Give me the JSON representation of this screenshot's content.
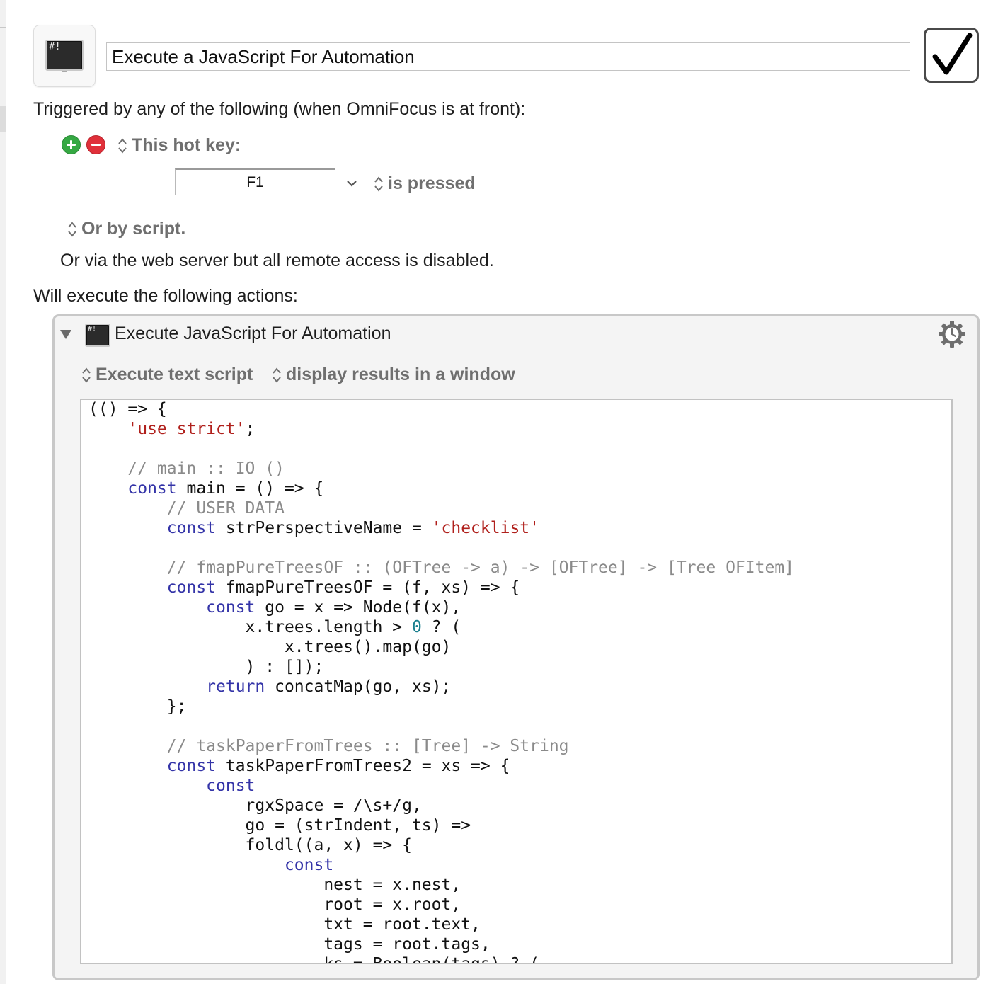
{
  "macro": {
    "icon": "terminal-icon",
    "icon_text": "#!",
    "name": "Execute a JavaScript For Automation",
    "enabled": true
  },
  "triggers": {
    "heading": "Triggered by any of the following (when OmniFocus is at front):",
    "trigger_type": "This hot key:",
    "hotkey": "F1",
    "hotkey_condition": "is pressed",
    "script_option": "Or by script.",
    "web_server_note": "Or via the web server but all remote access is disabled."
  },
  "actions": {
    "heading": "Will execute the following actions:",
    "items": [
      {
        "title": "Execute JavaScript For Automation",
        "icon": "terminal-icon",
        "icon_text": "#!",
        "source_option": "Execute text script",
        "output_option": "display results in a window",
        "code_lines": [
          [
            {
              "t": "(() => {",
              "c": "plain"
            }
          ],
          [
            {
              "t": "    ",
              "c": "plain"
            },
            {
              "t": "'use strict'",
              "c": "str"
            },
            {
              "t": ";",
              "c": "plain"
            }
          ],
          [
            {
              "t": "",
              "c": "plain"
            }
          ],
          [
            {
              "t": "    // main :: IO ()",
              "c": "com"
            }
          ],
          [
            {
              "t": "    ",
              "c": "plain"
            },
            {
              "t": "const",
              "c": "kw"
            },
            {
              "t": " main = () => {",
              "c": "plain"
            }
          ],
          [
            {
              "t": "        // USER DATA",
              "c": "com"
            }
          ],
          [
            {
              "t": "        ",
              "c": "plain"
            },
            {
              "t": "const",
              "c": "kw"
            },
            {
              "t": " strPerspectiveName = ",
              "c": "plain"
            },
            {
              "t": "'checklist'",
              "c": "str"
            }
          ],
          [
            {
              "t": "",
              "c": "plain"
            }
          ],
          [
            {
              "t": "        // fmapPureTreesOF :: (OFTree -> a) -> [OFTree] -> [Tree OFItem]",
              "c": "com"
            }
          ],
          [
            {
              "t": "        ",
              "c": "plain"
            },
            {
              "t": "const",
              "c": "kw"
            },
            {
              "t": " fmapPureTreesOF = (f, xs) => {",
              "c": "plain"
            }
          ],
          [
            {
              "t": "            ",
              "c": "plain"
            },
            {
              "t": "const",
              "c": "kw"
            },
            {
              "t": " go = x => Node(f(x),",
              "c": "plain"
            }
          ],
          [
            {
              "t": "                x.trees.length > ",
              "c": "plain"
            },
            {
              "t": "0",
              "c": "num"
            },
            {
              "t": " ? (",
              "c": "plain"
            }
          ],
          [
            {
              "t": "                    x.trees().map(go)",
              "c": "plain"
            }
          ],
          [
            {
              "t": "                ) : []);",
              "c": "plain"
            }
          ],
          [
            {
              "t": "            ",
              "c": "plain"
            },
            {
              "t": "return",
              "c": "kw"
            },
            {
              "t": " concatMap(go, xs);",
              "c": "plain"
            }
          ],
          [
            {
              "t": "        };",
              "c": "plain"
            }
          ],
          [
            {
              "t": "",
              "c": "plain"
            }
          ],
          [
            {
              "t": "        // taskPaperFromTrees :: [Tree] -> String",
              "c": "com"
            }
          ],
          [
            {
              "t": "        ",
              "c": "plain"
            },
            {
              "t": "const",
              "c": "kw"
            },
            {
              "t": " taskPaperFromTrees2 = xs => {",
              "c": "plain"
            }
          ],
          [
            {
              "t": "            ",
              "c": "plain"
            },
            {
              "t": "const",
              "c": "kw"
            }
          ],
          [
            {
              "t": "                rgxSpace = /\\s+/g,",
              "c": "plain"
            }
          ],
          [
            {
              "t": "                go = (strIndent, ts) =>",
              "c": "plain"
            }
          ],
          [
            {
              "t": "                foldl((a, x) => {",
              "c": "plain"
            }
          ],
          [
            {
              "t": "                    ",
              "c": "plain"
            },
            {
              "t": "const",
              "c": "kw"
            }
          ],
          [
            {
              "t": "                        nest = x.nest,",
              "c": "plain"
            }
          ],
          [
            {
              "t": "                        root = x.root,",
              "c": "plain"
            }
          ],
          [
            {
              "t": "                        txt = root.text,",
              "c": "plain"
            }
          ],
          [
            {
              "t": "                        tags = root.tags,",
              "c": "plain"
            }
          ],
          [
            {
              "t": "                        ks = Boolean(tags) ? (",
              "c": "plain"
            }
          ]
        ]
      }
    ]
  },
  "colors": {
    "keyword": "#3434a8",
    "string": "#b0201c",
    "comment": "#8a8a8a",
    "number": "#1a7f8e",
    "add_button": "#35a843",
    "remove_button": "#e0303a"
  },
  "icons": {
    "add": "plus-circle-icon",
    "remove": "minus-circle-icon",
    "popup": "up-down-chevron-icon",
    "dropdown": "chevron-down-icon",
    "disclosure": "disclosure-triangle-icon",
    "gear": "gear-clock-icon",
    "enabled": "checkmark-icon"
  }
}
